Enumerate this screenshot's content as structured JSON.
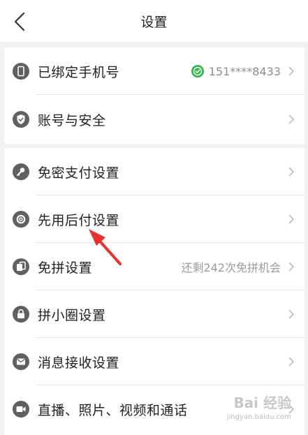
{
  "header": {
    "title": "设置",
    "back_icon": "chevron-left-icon"
  },
  "groups": [
    {
      "items": [
        {
          "label": "已绑定手机号",
          "icon": "phone-icon",
          "value": "151****8433",
          "value_icon": "verified-check-icon"
        },
        {
          "label": "账号与安全",
          "icon": "shield-icon"
        }
      ]
    },
    {
      "items": [
        {
          "label": "免密支付设置",
          "icon": "key-icon"
        },
        {
          "label": "先用后付设置",
          "icon": "badge-gear-icon"
        },
        {
          "label": "免拼设置",
          "icon": "cards-icon",
          "value": "还剩242次免拼机会"
        },
        {
          "label": "拼小圈设置",
          "icon": "lock-icon"
        },
        {
          "label": "消息接收设置",
          "icon": "mail-icon"
        },
        {
          "label": "直播、照片、视频和通话",
          "icon": "video-camera-icon"
        }
      ]
    }
  ],
  "colors": {
    "icon_bg": "#606060",
    "verified": "#2db84d",
    "arrow": "#e8322d"
  },
  "watermark": {
    "text": "Bai 经验",
    "sub": "jingyan.baidu.com"
  }
}
